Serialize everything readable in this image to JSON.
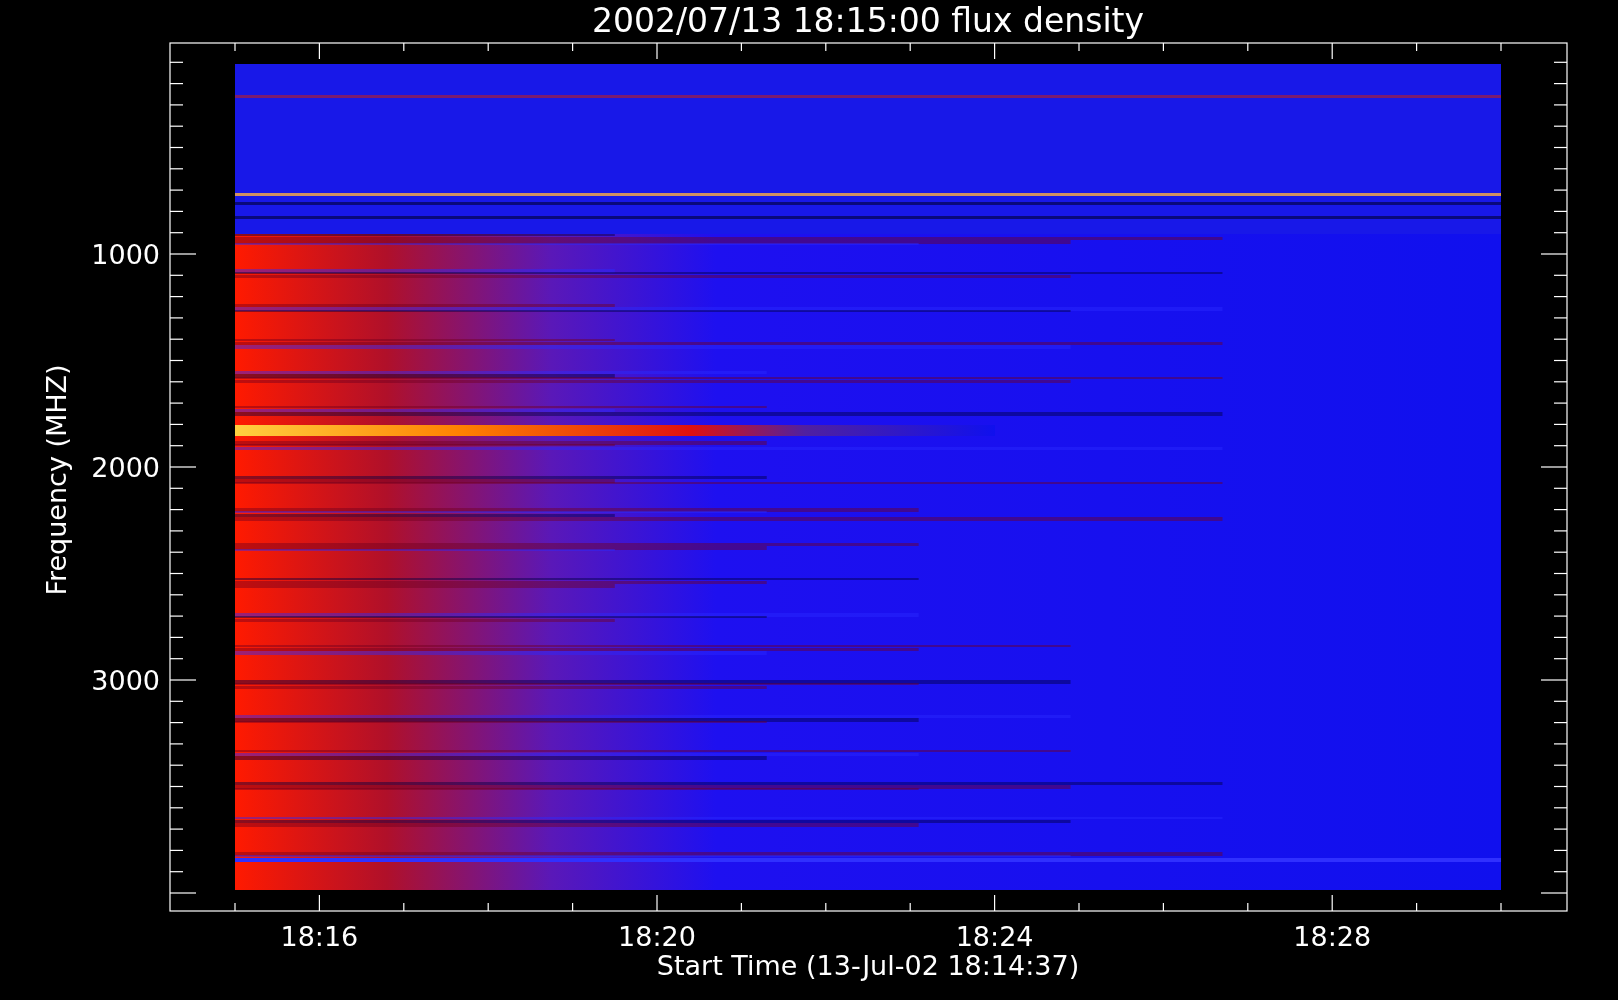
{
  "plot": {
    "title": "2002/07/13 18:15:00 flux density",
    "ylabel": "Frequency (MHZ)",
    "xlabel": "Start Time (13-Jul-02 18:14:37)",
    "y_tick_labels": [
      "1000",
      "2000",
      "3000"
    ],
    "x_tick_labels": [
      "18:16",
      "18:20",
      "18:24",
      "18:28"
    ]
  }
}
